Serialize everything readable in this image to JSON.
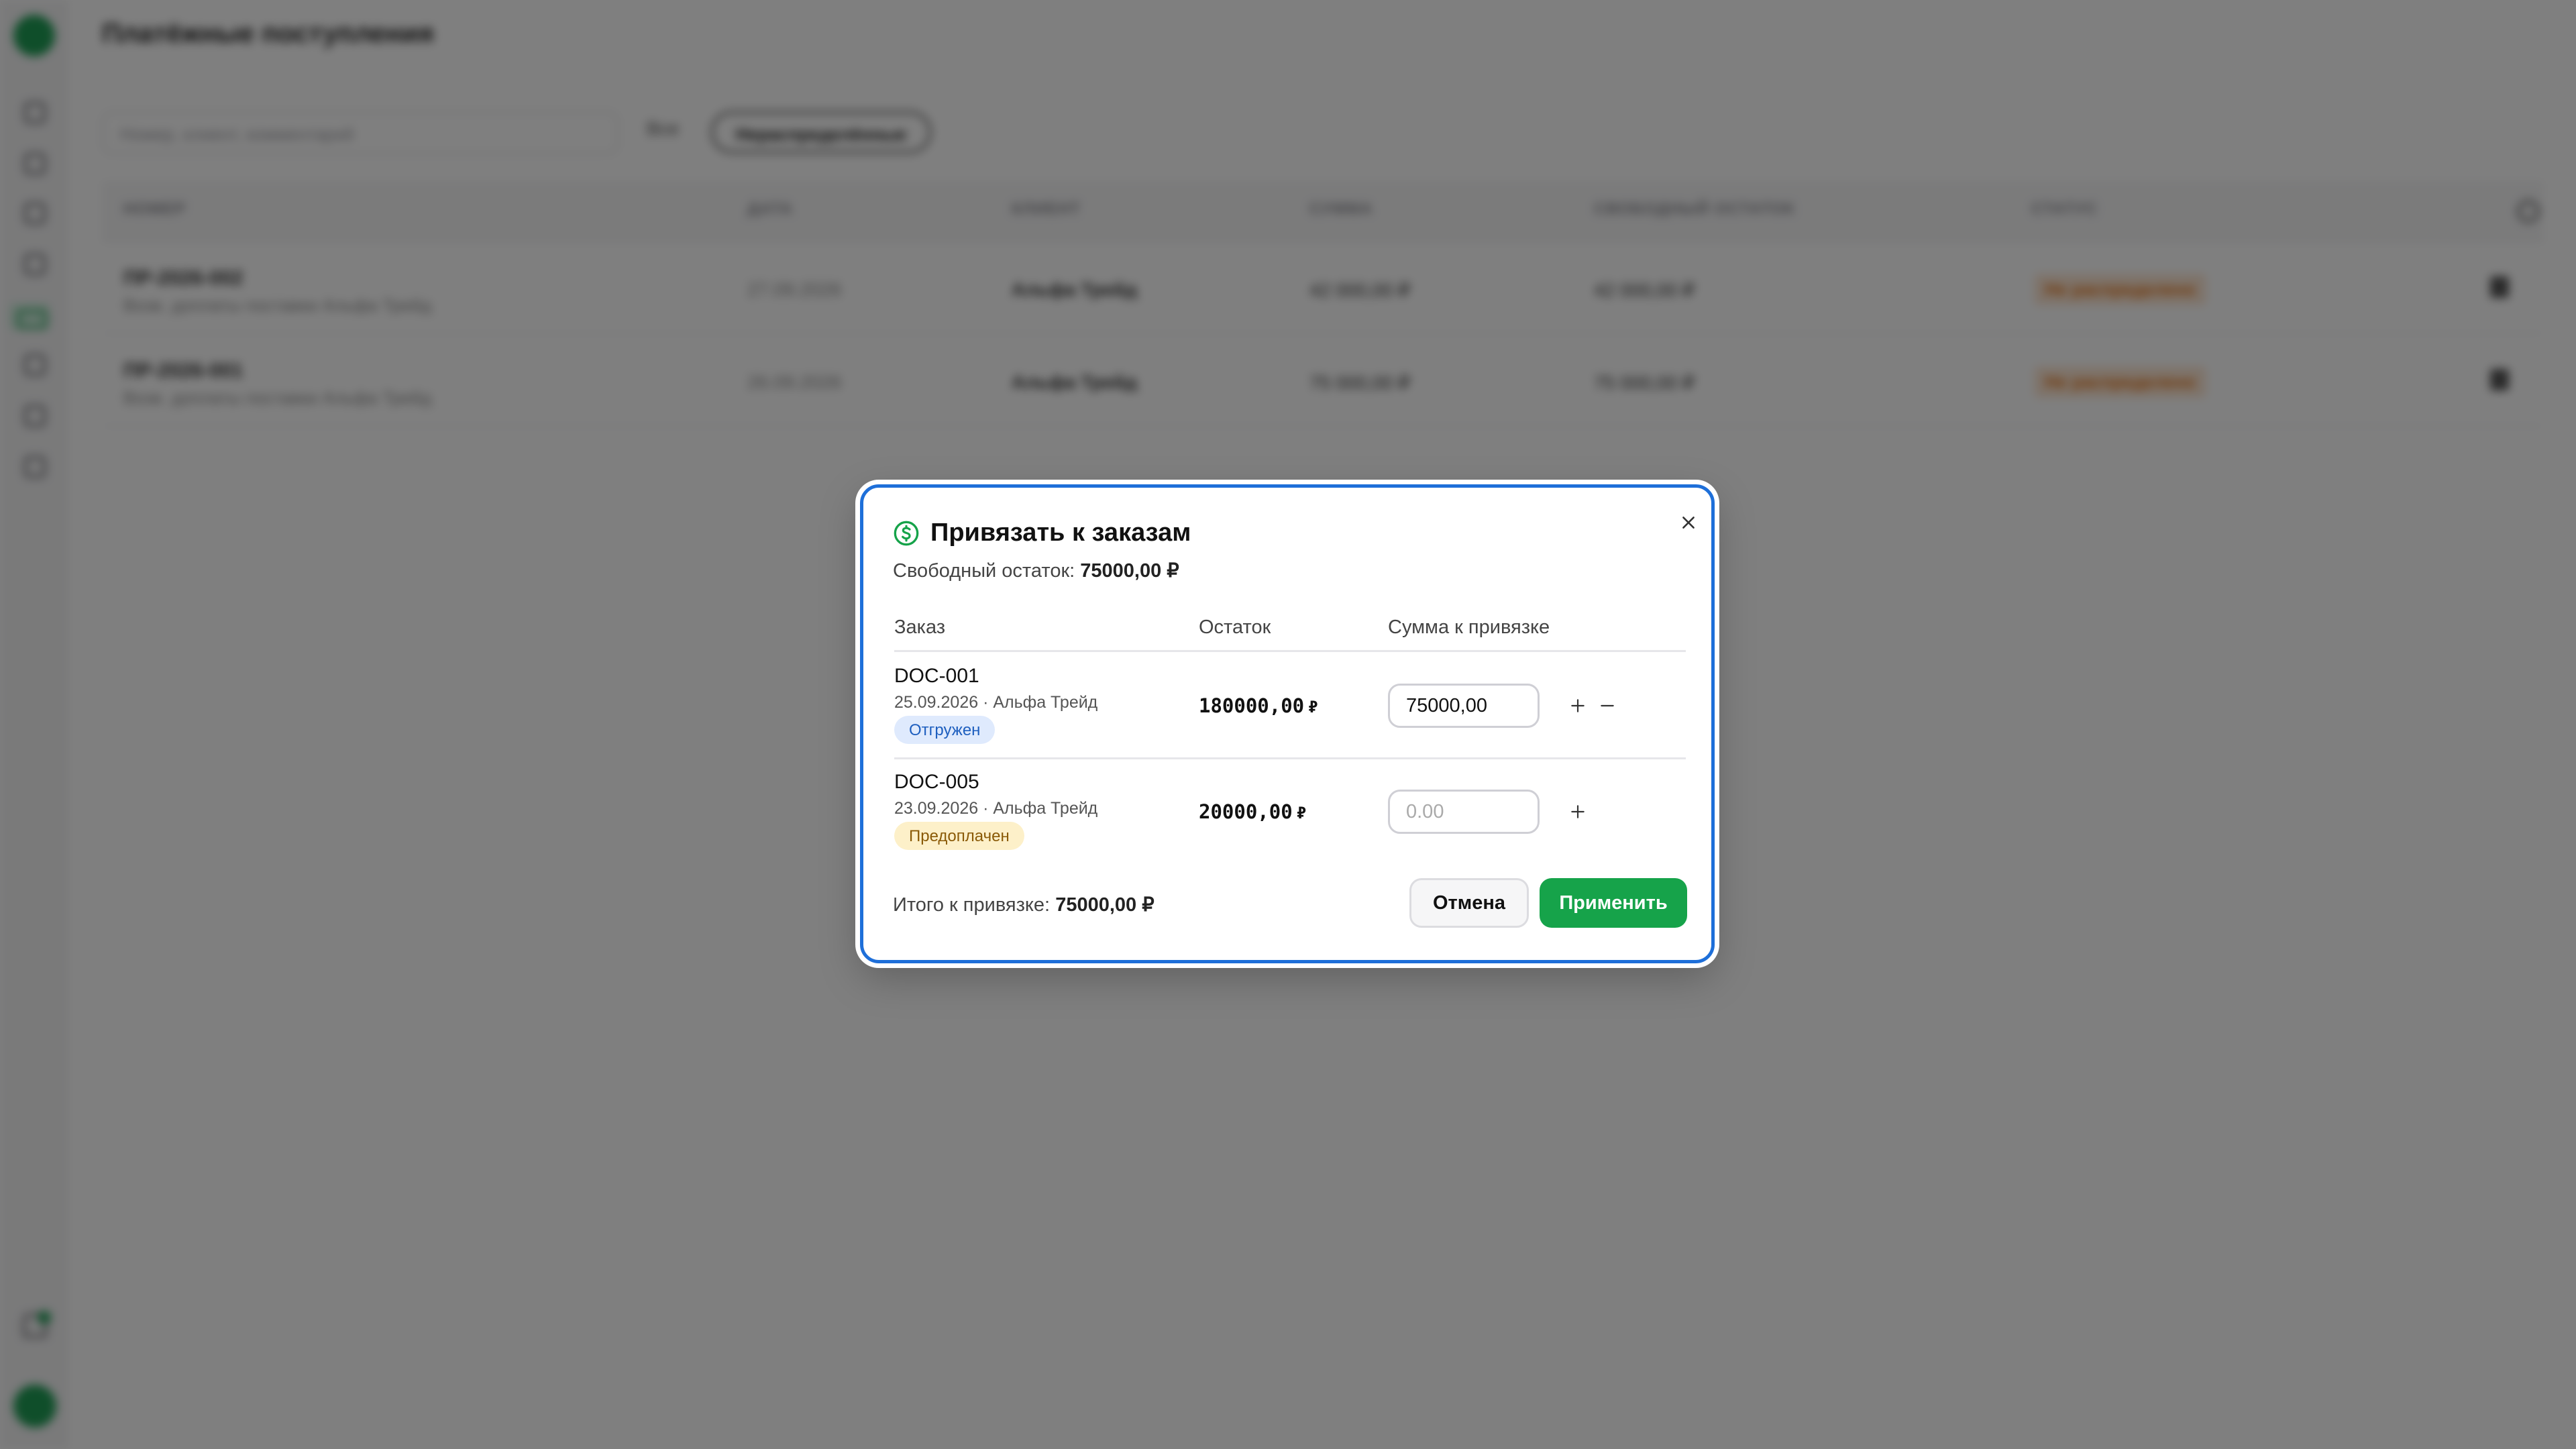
{
  "background": {
    "page_title": "Платёжные поступления",
    "search_placeholder": "Номер, клиент, комментарий",
    "filter_all": "Все",
    "filter_active": "Нераспределённые",
    "table": {
      "headers": [
        "НОМЕР",
        "ДАТА",
        "КЛИЕНТ",
        "СУММА",
        "СВОБОДНЫЙ ОСТАТОК",
        "СТАТУС"
      ],
      "rows": [
        {
          "number": "ПР-2026-002",
          "desc": "Возв. доплаты поставки Альфа Трейд",
          "date": "27.09.2026",
          "client": "Альфа Трейд",
          "amount": "42 000,00 ₽",
          "free": "42 000,00 ₽",
          "status": "Не распределено"
        },
        {
          "number": "ПР-2026-001",
          "desc": "Возв. доплаты поставки Альфа Трейд",
          "date": "26.09.2026",
          "client": "Альфа Трейд",
          "amount": "75 000,00 ₽",
          "free": "75 000,00 ₽",
          "status": "Не распределено"
        }
      ]
    }
  },
  "modal": {
    "title": "Привязать к заказам",
    "free_label": "Свободный остаток:",
    "free_value": "75000,00 ₽",
    "columns": {
      "order": "Заказ",
      "remain": "Остаток",
      "amount": "Сумма к привязке"
    },
    "orders": [
      {
        "id": "DOC-001",
        "meta": "25.09.2026 · Альфа Трейд",
        "status": "Отгружен",
        "remain": "180000,00",
        "currency": "₽",
        "amount_value": "75000,00",
        "amount_placeholder": ""
      },
      {
        "id": "DOC-005",
        "meta": "23.09.2026 · Альфа Трейд",
        "status": "Предоплачен",
        "remain": "20000,00",
        "currency": "₽",
        "amount_value": "",
        "amount_placeholder": "0.00"
      }
    ],
    "total_label": "Итого к привязке:",
    "total_value": "75000,00 ₽",
    "cancel_label": "Отмена",
    "apply_label": "Применить"
  },
  "colors": {
    "accent": "#16a34a",
    "focus_ring": "#1e6fd9",
    "badge_shipped_bg": "#dfeafd",
    "badge_prepaid_bg": "#fdf0c9"
  }
}
